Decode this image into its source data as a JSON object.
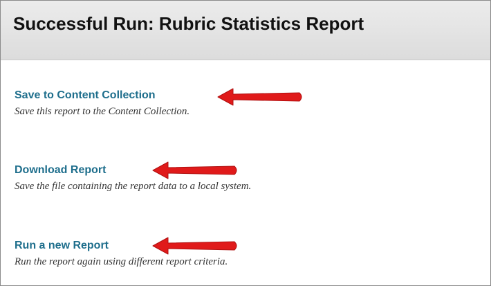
{
  "header": {
    "title": "Successful Run: Rubric Statistics Report"
  },
  "options": [
    {
      "link": "Save to Content Collection",
      "description": "Save this report to the Content Collection."
    },
    {
      "link": "Download Report",
      "description": "Save the file containing the report data to a local system."
    },
    {
      "link": "Run a new Report",
      "description": "Run the report again using different report criteria."
    }
  ],
  "annotations": {
    "arrow_color": "#e01a1a",
    "arrow_icon": "red-arrow-left-icon"
  },
  "colors": {
    "link": "#1e6e8c",
    "header_bg": "#e4e4e4"
  }
}
